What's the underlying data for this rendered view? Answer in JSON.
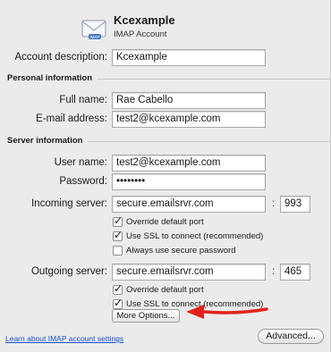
{
  "header": {
    "account_name": "Kcexample",
    "account_type": "IMAP Account",
    "icon": "envelope-imap-icon"
  },
  "account": {
    "description_label": "Account description:",
    "description_value": "Kcexample"
  },
  "personal": {
    "section_title": "Personal information",
    "full_name_label": "Full name:",
    "full_name_value": "Rae Cabello",
    "email_label": "E-mail address:",
    "email_value": "test2@kcexample.com"
  },
  "server": {
    "section_title": "Server information",
    "username_label": "User name:",
    "username_value": "test2@kcexample.com",
    "password_label": "Password:",
    "password_value": "••••••••",
    "incoming_label": "Incoming server:",
    "incoming_value": "secure.emailsrvr.com",
    "incoming_port": "993",
    "incoming_override": "Override default port",
    "incoming_ssl": "Use SSL to connect (recommended)",
    "incoming_secure_pw": "Always use secure password",
    "outgoing_label": "Outgoing server:",
    "outgoing_value": "secure.emailsrvr.com",
    "outgoing_port": "465",
    "outgoing_override": "Override default port",
    "outgoing_ssl": "Use SSL to connect (recommended)",
    "port_separator": ":"
  },
  "buttons": {
    "more_options": "More Options...",
    "advanced": "Advanced..."
  },
  "footer": {
    "learn_link": "Learn about IMAP account settings"
  },
  "colors": {
    "annotation_arrow": "#e0241b",
    "link": "#1a4fc9"
  }
}
